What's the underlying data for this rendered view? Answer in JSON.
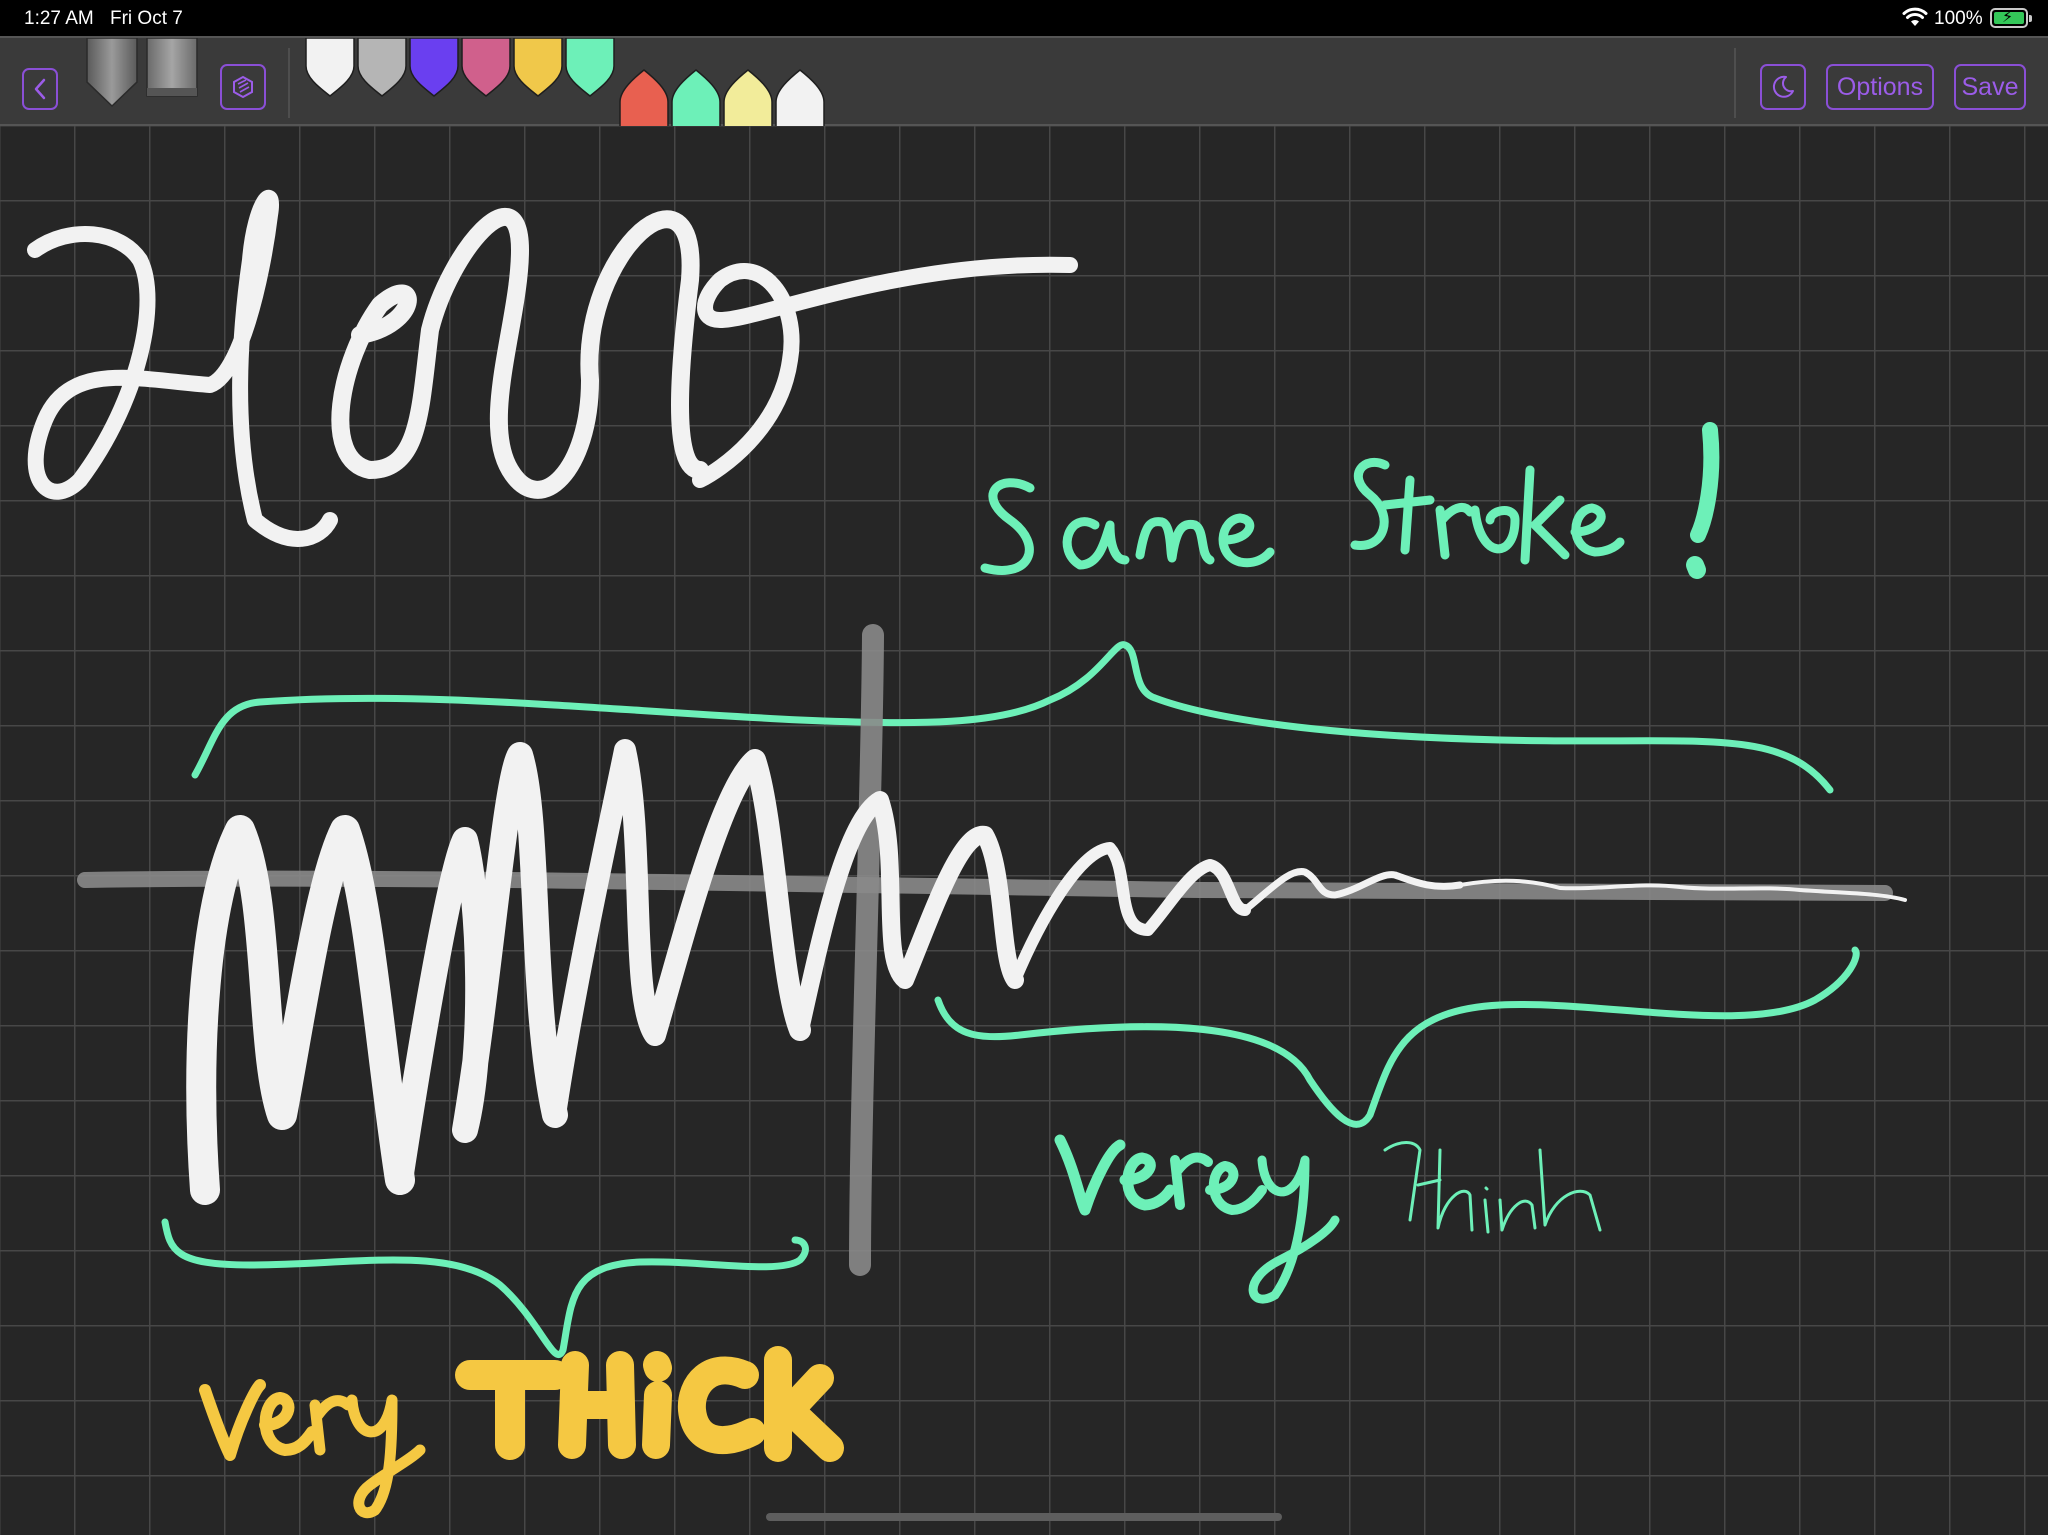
{
  "status_bar": {
    "time": "1:27 AM",
    "date": "Fri Oct 7",
    "battery_percent": "100%",
    "battery_level": 1.0,
    "wifi_icon": "wifi-icon",
    "battery_icon": "battery-charging-icon"
  },
  "toolbar": {
    "back_icon": "chevron-left-icon",
    "layers_icon": "cube-layers-icon",
    "dark_mode_icon": "moon-icon",
    "options_label": "Options",
    "save_label": "Save",
    "accent_color": "#9b5ce8",
    "tools": [
      {
        "name": "pen-gray",
        "color": "#8c8c8c"
      },
      {
        "name": "highlighter-gray",
        "color": "#9a9a9a"
      }
    ],
    "palette_row_1": [
      "#f2f2f2",
      "#b5b5b5",
      "#6a3ff0",
      "#d0608c",
      "#f0c84a",
      "#6df0b8"
    ],
    "palette_row_2": [
      "#e86050",
      "#6df0b8",
      "#f2ec9a",
      "#f2f2f2"
    ]
  },
  "canvas": {
    "background": "#262626",
    "grid_color": "#474747",
    "stroke_colors": {
      "white": "#f2f2f2",
      "mint": "#6df0b8",
      "yellow": "#f5c842",
      "gray": "#8a8a8a"
    },
    "handwriting": {
      "hello": "Hello",
      "same_stroke": "Same Stroke!",
      "very_thin_1": "very",
      "very_thin_2": "thin",
      "very_thick_1": "very",
      "very_thick_2": "THICK"
    }
  }
}
